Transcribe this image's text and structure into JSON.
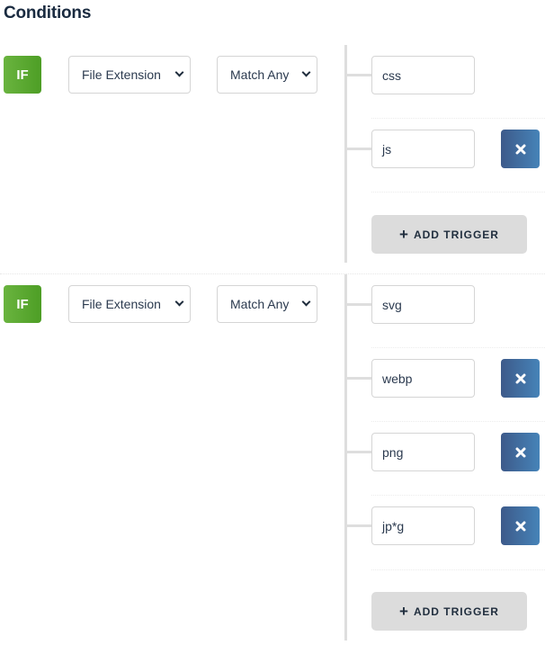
{
  "title": "Conditions",
  "groups": [
    {
      "badge": "IF",
      "field_select": "File Extension",
      "match_select": "Match Any",
      "triggers": [
        {
          "value": "css",
          "removable": false
        },
        {
          "value": "js",
          "removable": true
        }
      ],
      "add_label": "ADD TRIGGER",
      "add_icon": "+"
    },
    {
      "badge": "IF",
      "field_select": "File Extension",
      "match_select": "Match Any",
      "triggers": [
        {
          "value": "svg",
          "removable": false
        },
        {
          "value": "webp",
          "removable": true
        },
        {
          "value": "png",
          "removable": true
        },
        {
          "value": "jp*g",
          "removable": true
        }
      ],
      "add_label": "ADD TRIGGER",
      "add_icon": "+"
    }
  ],
  "colors": {
    "if_badge": "#55a52d",
    "remove_button": "#4370a3",
    "add_button": "#dcdcdc",
    "title": "#1a2b40"
  }
}
